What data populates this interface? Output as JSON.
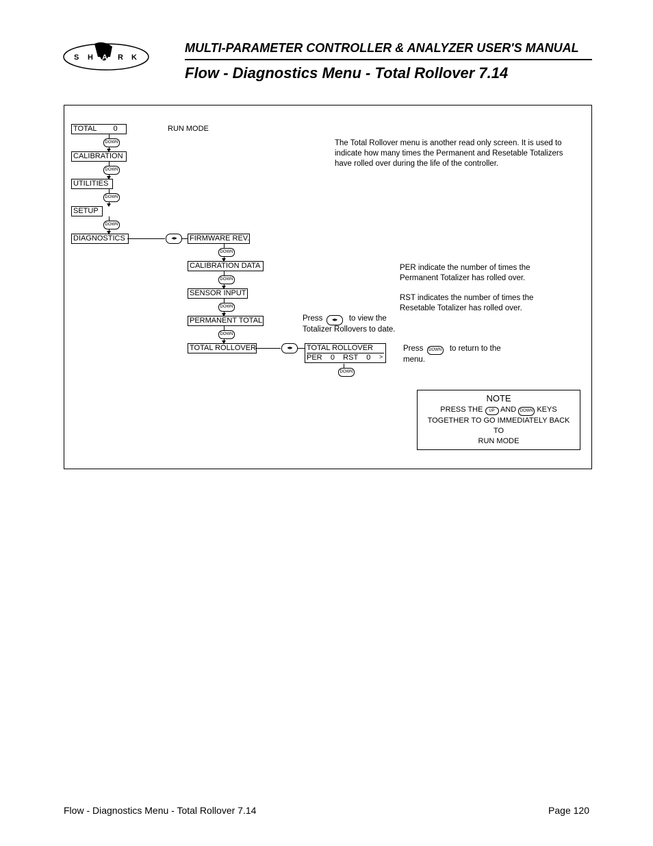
{
  "header": {
    "manual_title": "MULTI-PARAMETER CONTROLLER & ANALYZER USER'S MANUAL",
    "section_title": "Flow - Diagnostics Menu - Total Rollover 7.14",
    "logo_letters": [
      "S",
      "H",
      "A",
      "R",
      "K"
    ]
  },
  "menu": {
    "total": "TOTAL",
    "total_value": "0",
    "run_mode": "RUN MODE",
    "calibration": "CALIBRATION",
    "utilities": "UTILITIES",
    "setup": "SETUP",
    "diagnostics": "DIAGNOSTICS",
    "firmware_rev": "FIRMWARE REV.",
    "calibration_data": "CALIBRATION DATA",
    "sensor_input": "SENSOR INPUT",
    "permanent_total": "PERMANENT TOTAL",
    "total_rollover": "TOTAL ROLLOVER",
    "total_rollover2_top": "TOTAL ROLLOVER",
    "total_rollover2_bottom": "PER    0    RST    0"
  },
  "buttons": {
    "down": "DOWN",
    "up": "UP",
    "enter": "◂ ▸"
  },
  "text": {
    "intro": "The Total Rollover menu is another read only screen. It is used to indicate how many times the Permanent and Resetable Totalizers have rolled over during the life of the controller.",
    "per_desc": "PER indicate the number of times the Permanent Totalizer has rolled over.",
    "rst_desc": "RST indicates the number of times the Resetable Totalizer has rolled over.",
    "press_view1": "Press",
    "press_view2": "to view the",
    "press_view3": "Totalizer Rollovers to date.",
    "press_return1": "Press",
    "press_return2": "to return to the",
    "press_return3": "menu."
  },
  "note": {
    "title": "NOTE",
    "line1a": "PRESS THE",
    "line1b": "AND",
    "line1c": "KEYS",
    "line2": "TOGETHER TO GO IMMEDIATELY BACK TO",
    "line3": "RUN MODE"
  },
  "footer": {
    "left": "Flow - Diagnostics Menu - Total Rollover 7.14",
    "right": "Page 120"
  }
}
